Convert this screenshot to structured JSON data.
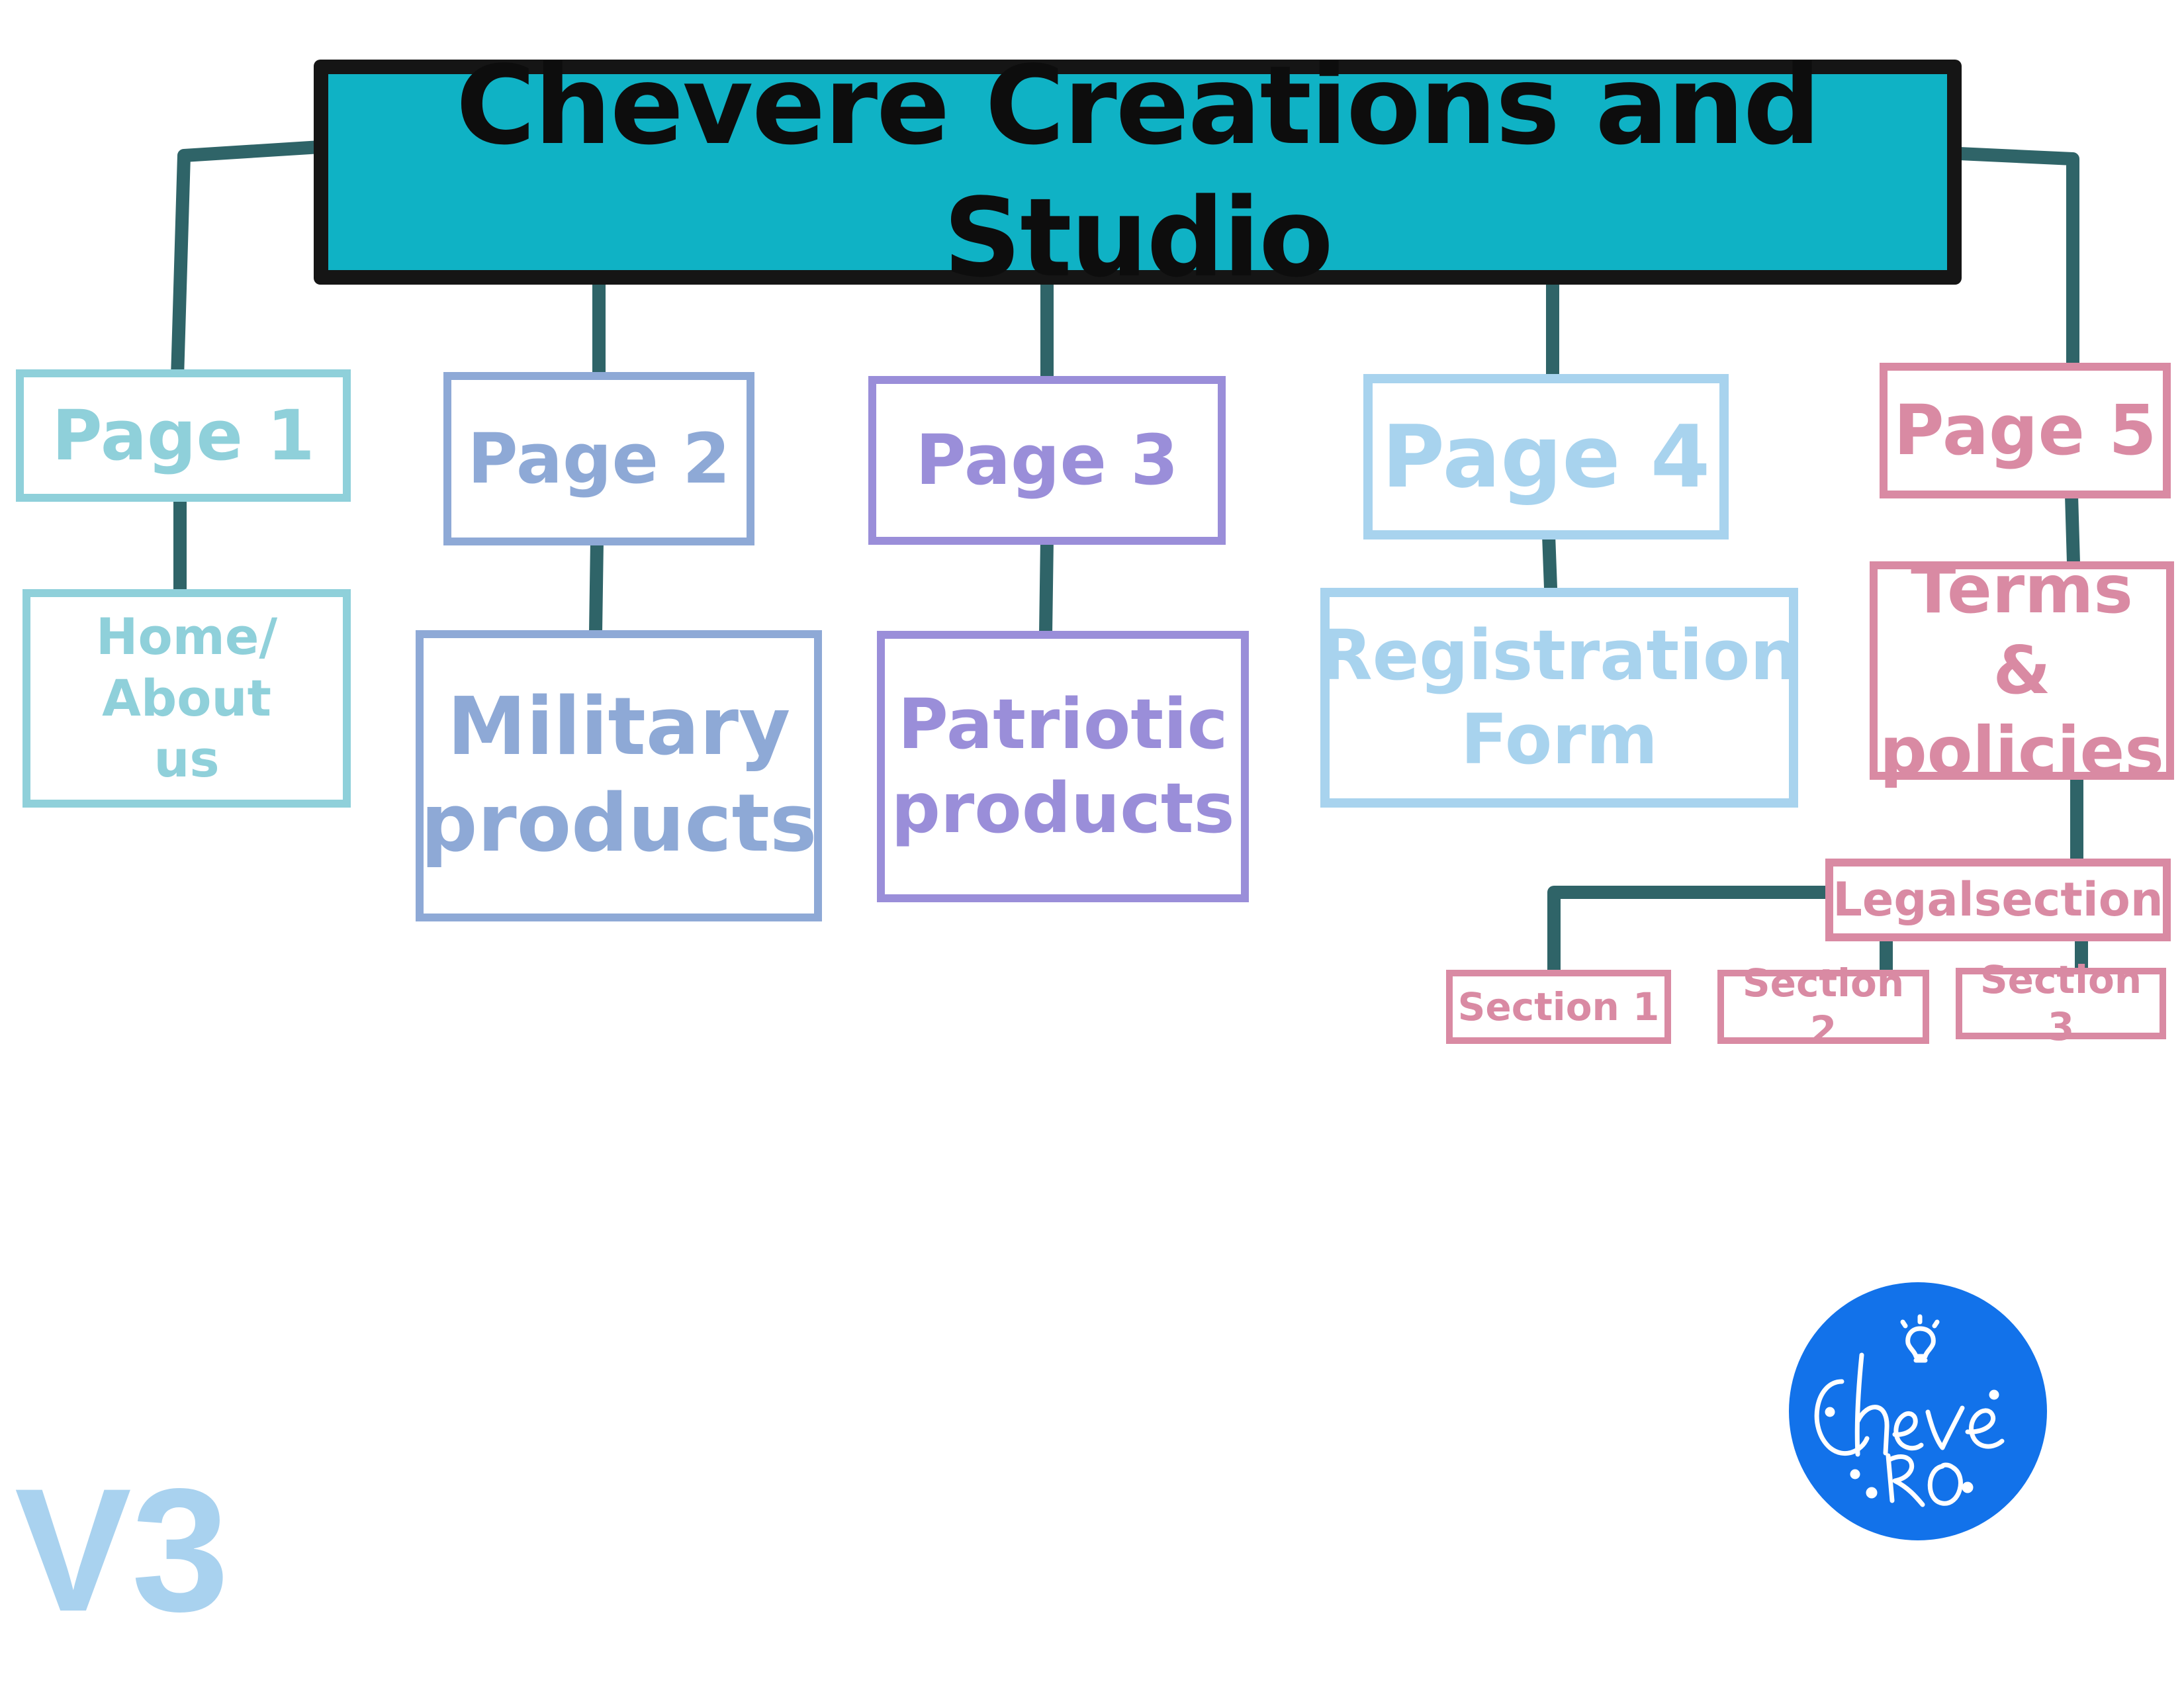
{
  "title": "Chevere Creations and Studio",
  "pages": [
    {
      "label": "Page 1",
      "child": "Home/\nAbout\nus"
    },
    {
      "label": "Page 2",
      "child": "Military\nproducts"
    },
    {
      "label": "Page 3",
      "child": "Patriotic\nproducts"
    },
    {
      "label": "Page 4",
      "child": "Registration\nForm"
    },
    {
      "label": "Page  5",
      "child": "Terms &\npolicies"
    }
  ],
  "legal": {
    "label": "Legalsection",
    "sections": [
      "Section 1",
      "Section 2",
      "Section 3"
    ]
  },
  "version": "V3",
  "logo": {
    "name": "Chevere logo"
  },
  "colors": {
    "title_fill": "#0fb2c5",
    "connector": "#2f6468",
    "page1": "#8fd0da",
    "page2": "#8ea9d6",
    "page3": "#9a8ed9",
    "page4": "#a8d3ee",
    "page5": "#d98aa3",
    "logo_fill": "#1272ea"
  }
}
